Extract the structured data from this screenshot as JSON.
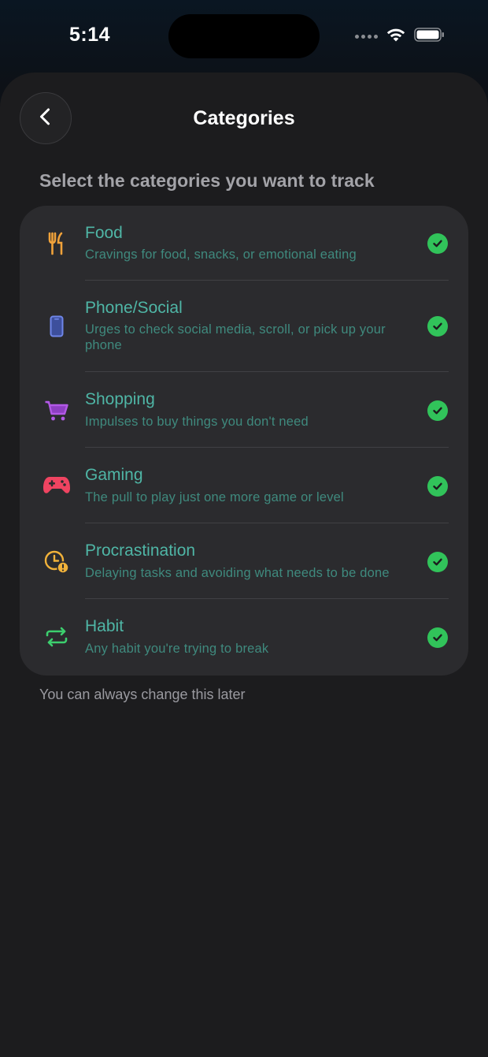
{
  "status_bar": {
    "time": "5:14"
  },
  "header": {
    "title": "Categories",
    "back_icon": "chevron-left-icon"
  },
  "prompt": "Select the categories you want to track",
  "categories": [
    {
      "title": "Food",
      "description": "Cravings for food, snacks, or emotional eating",
      "icon": "fork-knife-icon",
      "icon_color": "#f0a23a",
      "selected": true
    },
    {
      "title": "Phone/Social",
      "description": "Urges to check social media, scroll, or pick up your phone",
      "icon": "phone-icon",
      "icon_color": "#6f86e8",
      "selected": true
    },
    {
      "title": "Shopping",
      "description": "Impulses to buy things you don't need",
      "icon": "cart-icon",
      "icon_color": "#b259e6",
      "selected": true
    },
    {
      "title": "Gaming",
      "description": "The pull to play just one more game or level",
      "icon": "gamepad-icon",
      "icon_color": "#ef4461",
      "selected": true
    },
    {
      "title": "Procrastination",
      "description": "Delaying tasks and avoiding what needs to be done",
      "icon": "clock-alert-icon",
      "icon_color": "#f1b23a",
      "selected": true
    },
    {
      "title": "Habit",
      "description": "Any habit you're trying to break",
      "icon": "repeat-icon",
      "icon_color": "#3ccf6e",
      "selected": true
    }
  ],
  "footer_note": "You can always change this later",
  "colors": {
    "accent_text": "#4fb6a6",
    "check_green": "#31c35a",
    "card_bg": "#2b2b2e",
    "sheet_bg": "#1c1c1e"
  }
}
